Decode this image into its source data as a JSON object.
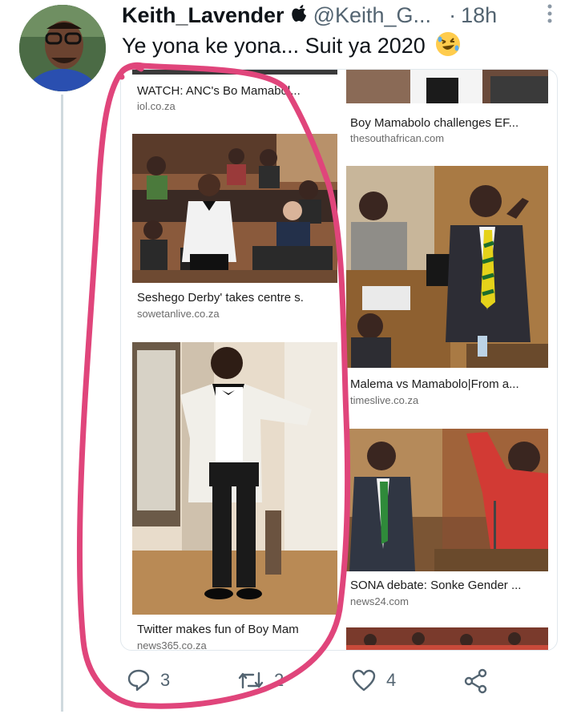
{
  "author": {
    "name": "Keith_Lavender",
    "verified_icon": "apple-icon",
    "handle": "@Keith_G...",
    "separator": "·",
    "time": "18h"
  },
  "tweet": {
    "text": "Ye yona ke yona... Suit ya 2020",
    "emoji": "rolling-on-floor-laughing-emoji"
  },
  "results": {
    "left": [
      {
        "title": "WATCH: ANC's Bo Mamabol...",
        "source": "iol.co.za"
      },
      {
        "title": "Seshego Derby' takes centre s.",
        "source": "sowetanlive.co.za"
      },
      {
        "title": "Twitter makes fun of Boy Mam",
        "source": "news365.co.za"
      }
    ],
    "right": [
      {
        "title": "Boy Mamabolo challenges EF...",
        "source": "thesouthafrican.com"
      },
      {
        "title": "Malema vs Mamabolo|From a...",
        "source": "timeslive.co.za"
      },
      {
        "title": "SONA debate: Sonke Gender ...",
        "source": "news24.com"
      }
    ]
  },
  "actions": {
    "reply_count": "3",
    "retweet_count": "2",
    "like_count": "4"
  },
  "colors": {
    "annotation": "#e0457b",
    "muted": "#536471",
    "text": "#0f1419"
  }
}
